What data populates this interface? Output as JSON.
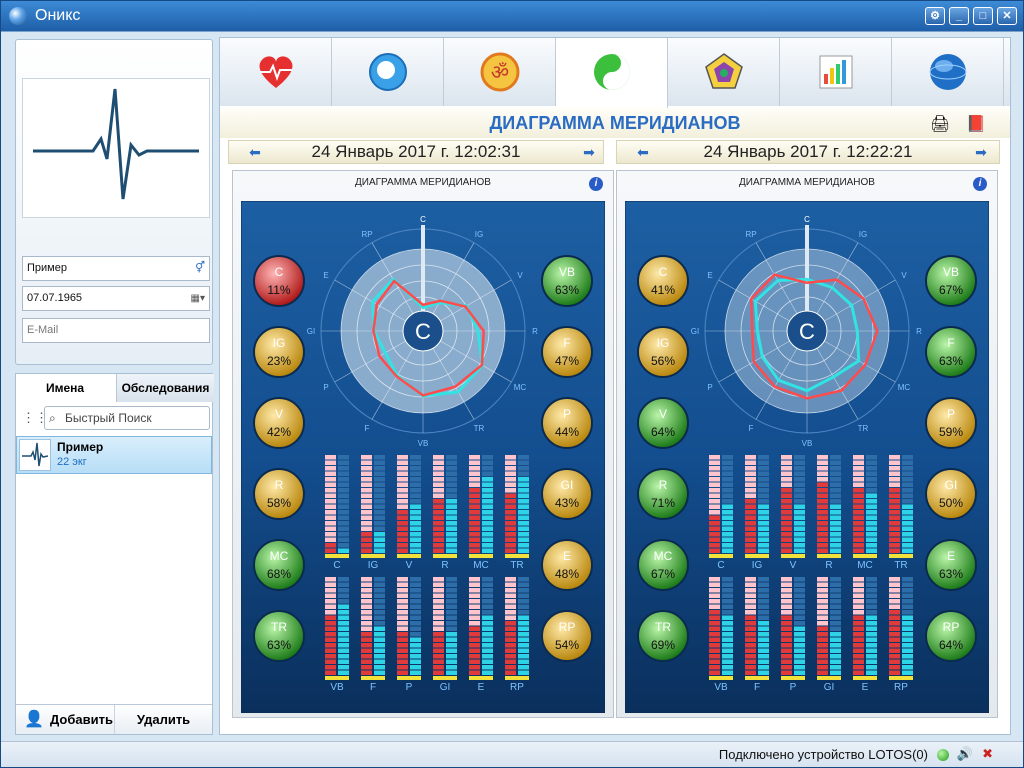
{
  "window": {
    "title": "Оникс"
  },
  "patient": {
    "name": "Пример",
    "birthdate": "07.07.1965",
    "email_placeholder": "E-Mail"
  },
  "left": {
    "tabs": [
      "Имена",
      "Обследования"
    ],
    "search_placeholder": "Быстрый Поиск",
    "list": [
      {
        "name": "Пример",
        "sub": "22 экг"
      }
    ],
    "add_label": "Добавить",
    "delete_label": "Удалить"
  },
  "main": {
    "tabs": [
      {
        "icon": "heart-icon"
      },
      {
        "icon": "head-icon"
      },
      {
        "icon": "om-icon"
      },
      {
        "icon": "yin-yang-icon"
      },
      {
        "icon": "pentagon-icon"
      },
      {
        "icon": "bar-chart-icon"
      },
      {
        "icon": "globe-icon"
      }
    ],
    "active_tab": 3,
    "title": "ДИАГРАММА МЕРИДИАНОВ",
    "left_date": "24 Январь 2017 г. 12:02:31",
    "right_date": "24 Январь 2017 г. 12:22:21"
  },
  "panels": [
    {
      "title": "ДИАГРАММА МЕРИДИАНОВ",
      "center": "C",
      "left_badges": [
        {
          "k": "C",
          "v": "11%",
          "c": "red"
        },
        {
          "k": "IG",
          "v": "23%",
          "c": "gold"
        },
        {
          "k": "V",
          "v": "42%",
          "c": "gold"
        },
        {
          "k": "R",
          "v": "58%",
          "c": "gold"
        },
        {
          "k": "MC",
          "v": "68%",
          "c": "green"
        },
        {
          "k": "TR",
          "v": "63%",
          "c": "green"
        }
      ],
      "right_badges": [
        {
          "k": "VB",
          "v": "63%",
          "c": "green"
        },
        {
          "k": "F",
          "v": "47%",
          "c": "gold"
        },
        {
          "k": "P",
          "v": "44%",
          "c": "gold"
        },
        {
          "k": "GI",
          "v": "43%",
          "c": "gold"
        },
        {
          "k": "E",
          "v": "48%",
          "c": "gold"
        },
        {
          "k": "RP",
          "v": "54%",
          "c": "gold"
        }
      ],
      "bars_top": {
        "labels": [
          "C",
          "IG",
          "V",
          "R",
          "MC",
          "TR"
        ],
        "red": [
          0.11,
          0.23,
          0.42,
          0.58,
          0.68,
          0.63
        ],
        "cyan": [
          0.08,
          0.22,
          0.48,
          0.55,
          0.75,
          0.78
        ]
      },
      "bars_bottom": {
        "labels": [
          "VB",
          "F",
          "P",
          "GI",
          "E",
          "RP"
        ],
        "red": [
          0.63,
          0.47,
          0.44,
          0.43,
          0.48,
          0.54
        ],
        "cyan": [
          0.7,
          0.5,
          0.38,
          0.46,
          0.6,
          0.62
        ]
      }
    },
    {
      "title": "ДИАГРАММА МЕРИДИАНОВ",
      "center": "C",
      "left_badges": [
        {
          "k": "C",
          "v": "41%",
          "c": "gold"
        },
        {
          "k": "IG",
          "v": "56%",
          "c": "gold"
        },
        {
          "k": "V",
          "v": "64%",
          "c": "green"
        },
        {
          "k": "R",
          "v": "71%",
          "c": "green"
        },
        {
          "k": "MC",
          "v": "67%",
          "c": "green"
        },
        {
          "k": "TR",
          "v": "69%",
          "c": "green"
        }
      ],
      "right_badges": [
        {
          "k": "VB",
          "v": "67%",
          "c": "green"
        },
        {
          "k": "F",
          "v": "63%",
          "c": "green"
        },
        {
          "k": "P",
          "v": "59%",
          "c": "gold"
        },
        {
          "k": "GI",
          "v": "50%",
          "c": "gold"
        },
        {
          "k": "E",
          "v": "63%",
          "c": "green"
        },
        {
          "k": "RP",
          "v": "64%",
          "c": "green"
        }
      ],
      "bars_top": {
        "labels": [
          "C",
          "IG",
          "V",
          "R",
          "MC",
          "TR"
        ],
        "red": [
          0.41,
          0.56,
          0.64,
          0.71,
          0.67,
          0.69
        ],
        "cyan": [
          0.5,
          0.48,
          0.5,
          0.48,
          0.62,
          0.52
        ]
      },
      "bars_bottom": {
        "labels": [
          "VB",
          "F",
          "P",
          "GI",
          "E",
          "RP"
        ],
        "red": [
          0.67,
          0.63,
          0.59,
          0.5,
          0.63,
          0.64
        ],
        "cyan": [
          0.62,
          0.58,
          0.5,
          0.47,
          0.62,
          0.6
        ]
      }
    }
  ],
  "status": {
    "text": "Подключено устройство LOTOS(0)"
  }
}
